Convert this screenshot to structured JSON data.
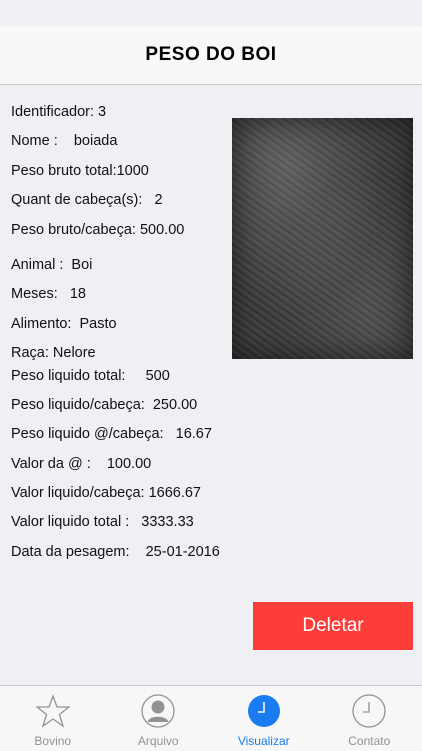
{
  "nav": {
    "title": "PESO DO BOI"
  },
  "details": {
    "identificador": "Identificador: 3",
    "nome": "Nome :    boiada",
    "peso_bruto_total": "Peso bruto total:1000",
    "quant_cabecas": "Quant de cabeça(s):   2",
    "peso_bruto_cabeca": "Peso bruto/cabeça: 500.00",
    "animal": "Animal :  Boi",
    "meses": "Meses:   18",
    "alimento": "Alimento:  Pasto",
    "raca": "Raça: Nelore",
    "peso_liquido_total": "Peso liquido total:     500",
    "peso_liquido_cabeca": "Peso liquido/cabeça:  250.00",
    "peso_liquido_arroba_cabeca": "Peso liquido @/cabeça:   16.67",
    "valor_arroba": "Valor da @ :    100.00",
    "valor_liquido_cabeca": "Valor liquido/cabeça: 1666.67",
    "valor_liquido_total": "Valor liquido total :   3333.33",
    "data_pesagem": "Data da pesagem:    25-01-2016"
  },
  "actions": {
    "delete_label": "Deletar"
  },
  "tabs": [
    {
      "label": "Bovino",
      "icon": "star-icon",
      "active": false
    },
    {
      "label": "Arquivo",
      "icon": "person-icon",
      "active": false
    },
    {
      "label": "Visualizar",
      "icon": "clock-icon",
      "active": true
    },
    {
      "label": "Contato",
      "icon": "clock-icon",
      "active": false
    }
  ],
  "colors": {
    "accent": "#1a7cf0",
    "delete": "#fc3d39",
    "inactive_tab": "#929292"
  }
}
